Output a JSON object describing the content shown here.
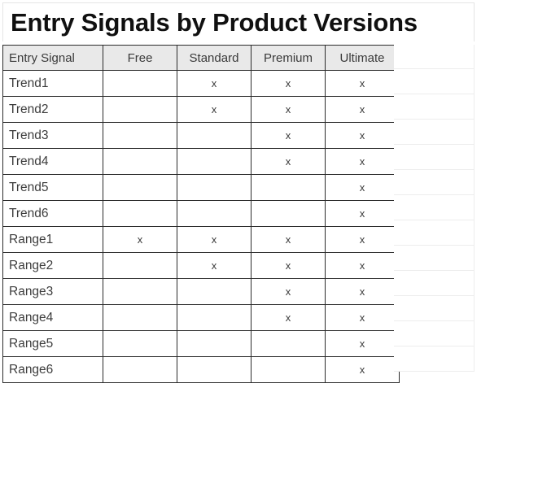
{
  "title": "Entry Signals by Product Versions",
  "table": {
    "columns": [
      "Entry Signal",
      "Free",
      "Standard",
      "Premium",
      "Ultimate"
    ],
    "mark": "x",
    "rows": [
      {
        "signal": "Trend1",
        "free": "",
        "standard": "x",
        "premium": "x",
        "ultimate": "x"
      },
      {
        "signal": "Trend2",
        "free": "",
        "standard": "x",
        "premium": "x",
        "ultimate": "x"
      },
      {
        "signal": "Trend3",
        "free": "",
        "standard": "",
        "premium": "x",
        "ultimate": "x"
      },
      {
        "signal": "Trend4",
        "free": "",
        "standard": "",
        "premium": "x",
        "ultimate": "x"
      },
      {
        "signal": "Trend5",
        "free": "",
        "standard": "",
        "premium": "",
        "ultimate": "x"
      },
      {
        "signal": "Trend6",
        "free": "",
        "standard": "",
        "premium": "",
        "ultimate": "x"
      },
      {
        "signal": "Range1",
        "free": "x",
        "standard": "x",
        "premium": "x",
        "ultimate": "x"
      },
      {
        "signal": "Range2",
        "free": "",
        "standard": "x",
        "premium": "x",
        "ultimate": "x"
      },
      {
        "signal": "Range3",
        "free": "",
        "standard": "",
        "premium": "x",
        "ultimate": "x"
      },
      {
        "signal": "Range4",
        "free": "",
        "standard": "",
        "premium": "x",
        "ultimate": "x"
      },
      {
        "signal": "Range5",
        "free": "",
        "standard": "",
        "premium": "",
        "ultimate": "x"
      },
      {
        "signal": "Range6",
        "free": "",
        "standard": "",
        "premium": "",
        "ultimate": "x"
      }
    ]
  },
  "colors": {
    "header_background": "#e9e9e9",
    "grid_line": "#2b2b2b",
    "faint_grid_line": "#ededed",
    "text": "#3a3a3a",
    "title_text": "#101010"
  }
}
